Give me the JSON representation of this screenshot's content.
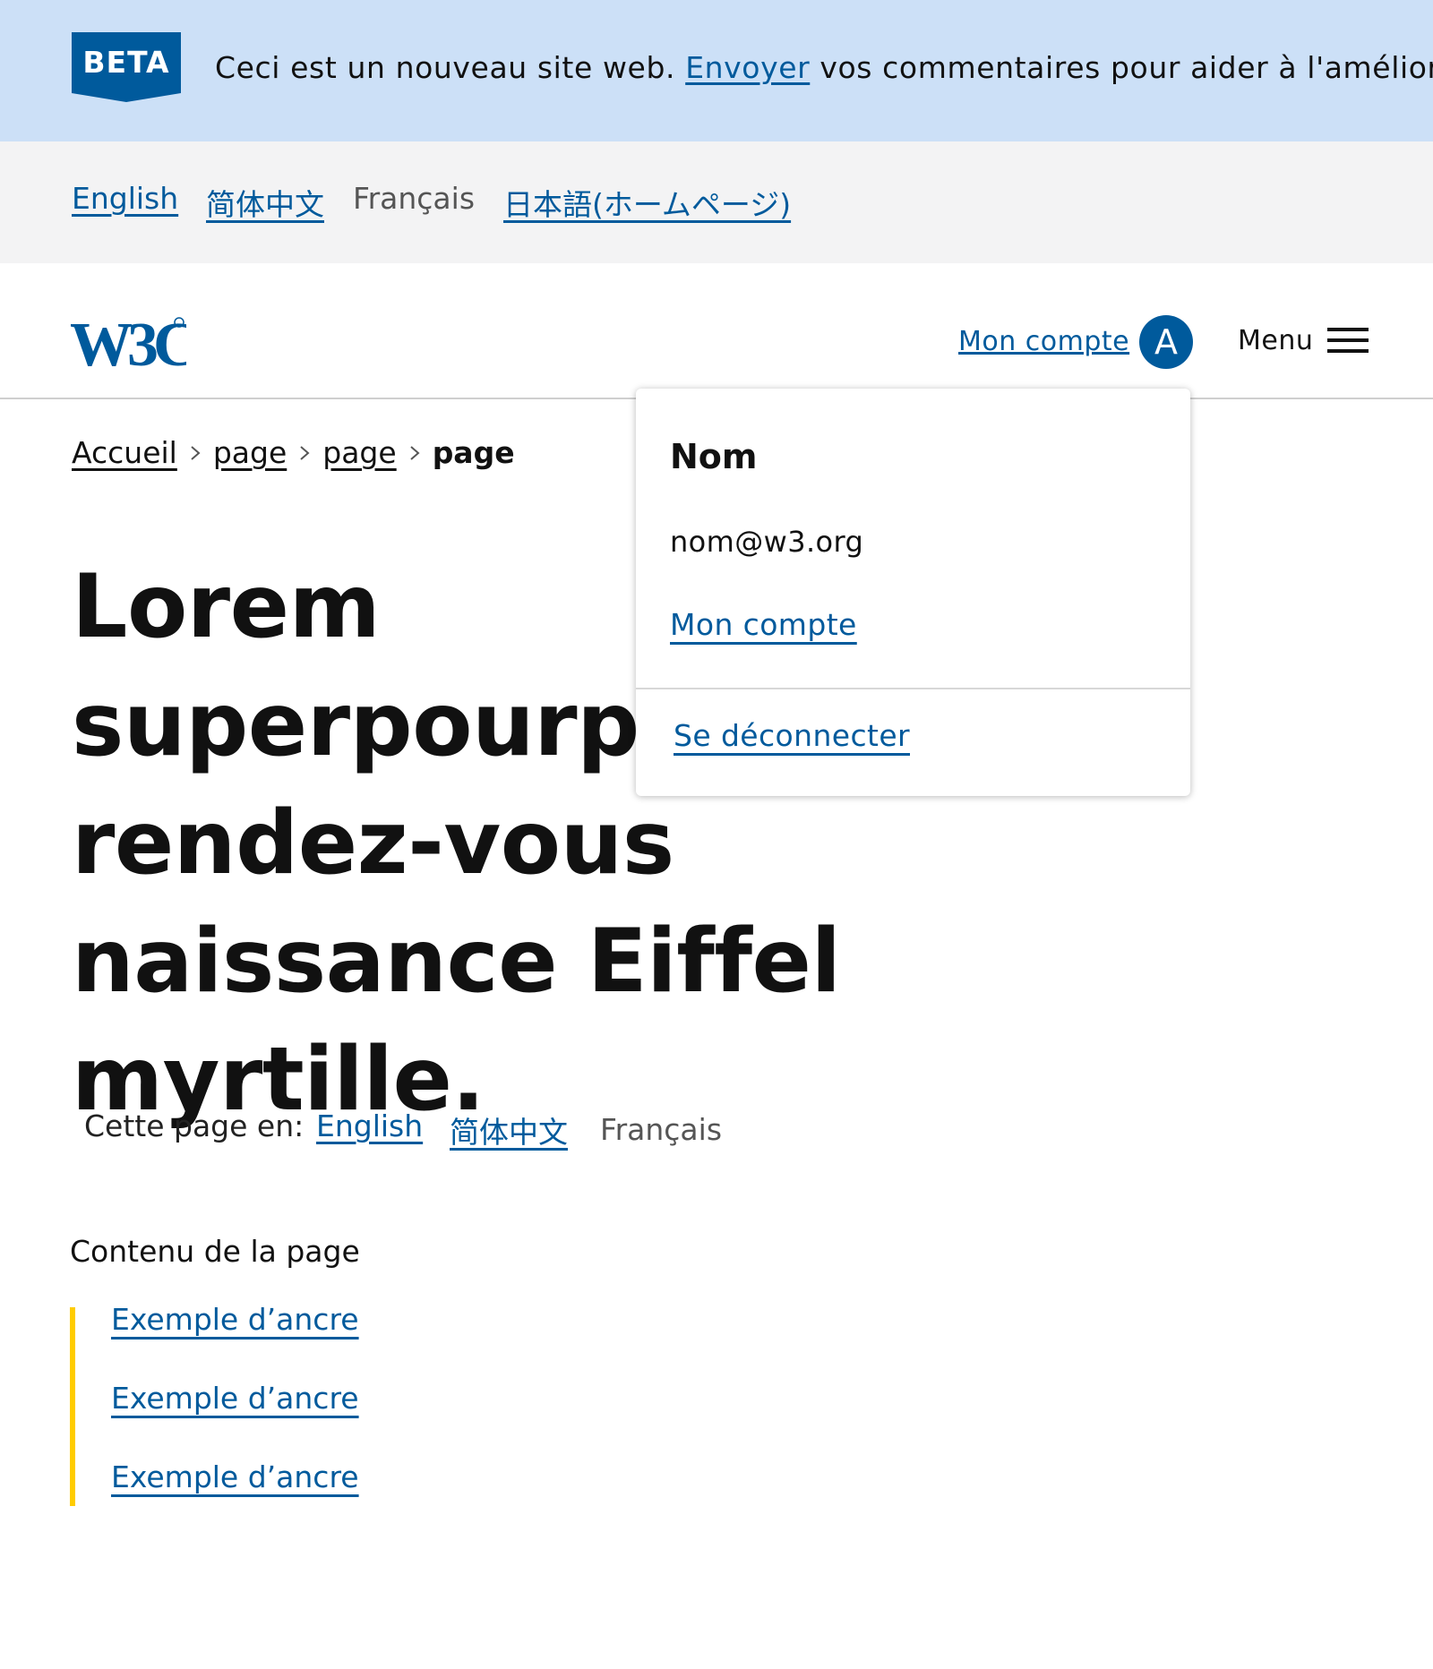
{
  "beta_banner": {
    "badge": "BETA",
    "text_before": "Ceci est un nouveau site web.",
    "link_label": "Envoyer",
    "text_after": "vos commentaires pour aider à l'améliorer"
  },
  "language_bar": {
    "links": [
      "English",
      "简体中文"
    ],
    "current": "Français",
    "japanese_link": "日本語(ホームページ)"
  },
  "header": {
    "logo_alt": "W3C",
    "account_label": "Mon compte",
    "avatar_letter": "A",
    "menu_label": "Menu"
  },
  "breadcrumb": {
    "items": [
      "Accueil",
      "page",
      "page"
    ],
    "current": "page"
  },
  "page": {
    "title": "Lorem superpourparlers rendez-vous naissance Eiffel myrtille.",
    "title_lines": [
      "Lorem superpourparlers r",
      "pourparlers r",
      "rendez-vous naissance",
      "Eiffel myrtille."
    ]
  },
  "page_languages": {
    "label": "Cette page en:",
    "links": [
      "English",
      "简体中文"
    ],
    "current": "Français"
  },
  "toc": {
    "title": "Contenu de la page",
    "items": [
      "Exemple d’ancre",
      "Exemple d’ancre",
      "Exemple d’ancre"
    ]
  },
  "account_dropdown": {
    "name": "Nom",
    "email": "nom@w3.org",
    "account_link": "Mon compte",
    "logout_link": "Se déconnecter"
  },
  "colors": {
    "primary_blue": "#005a9c",
    "beta_banner_bg": "#cce0f7",
    "language_bar_bg": "#f3f3f4",
    "toc_accent": "#ffcc00"
  }
}
